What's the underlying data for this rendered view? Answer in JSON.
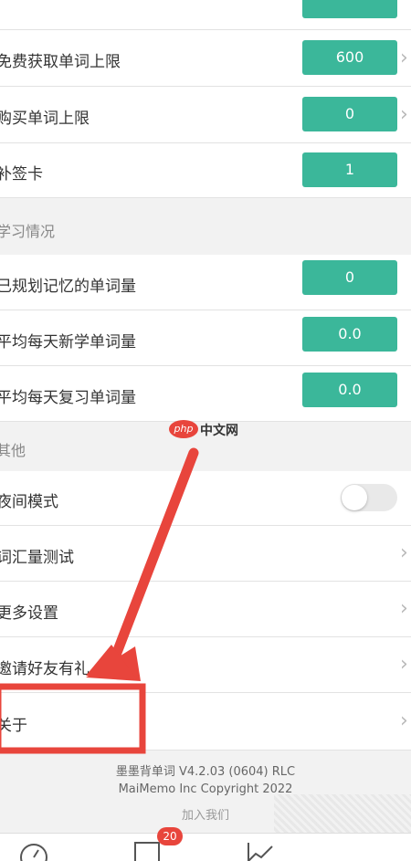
{
  "settings": {
    "top_partial_row": {
      "pill_value": ""
    },
    "free_limit": {
      "label": "免费获取单词上限",
      "value": "600"
    },
    "buy_limit": {
      "label": "购买单词上限",
      "value": "0"
    },
    "sign_card": {
      "label": "补签卡",
      "value": "1"
    }
  },
  "learning": {
    "section_title": "学习情况",
    "planned": {
      "label": "已规划记忆的单词量",
      "value": "0"
    },
    "avg_new": {
      "label": "平均每天新学单词量",
      "value": "0.0"
    },
    "avg_review": {
      "label": "平均每天复习单词量",
      "value": "0.0"
    }
  },
  "other": {
    "section_title": "其他",
    "night_mode": {
      "label": "夜间模式",
      "on": false
    },
    "vocab_test": {
      "label": "词汇量测试"
    },
    "more_settings": {
      "label": "更多设置"
    },
    "invite": {
      "label": "邀请好友有礼"
    },
    "about": {
      "label": "关于"
    }
  },
  "footer": {
    "version": "墨墨背单词 V4.2.03 (0604) RLC",
    "copyright": "MaiMemo Inc Copyright 2022",
    "join": "加入我们"
  },
  "tabbar": {
    "badge": "20"
  },
  "watermark_logo": {
    "badge_text": "php",
    "site_text": "中文网"
  },
  "colors": {
    "accent": "#3bb79a",
    "annotation_red": "#e8453c",
    "badge": "#e8453c"
  }
}
